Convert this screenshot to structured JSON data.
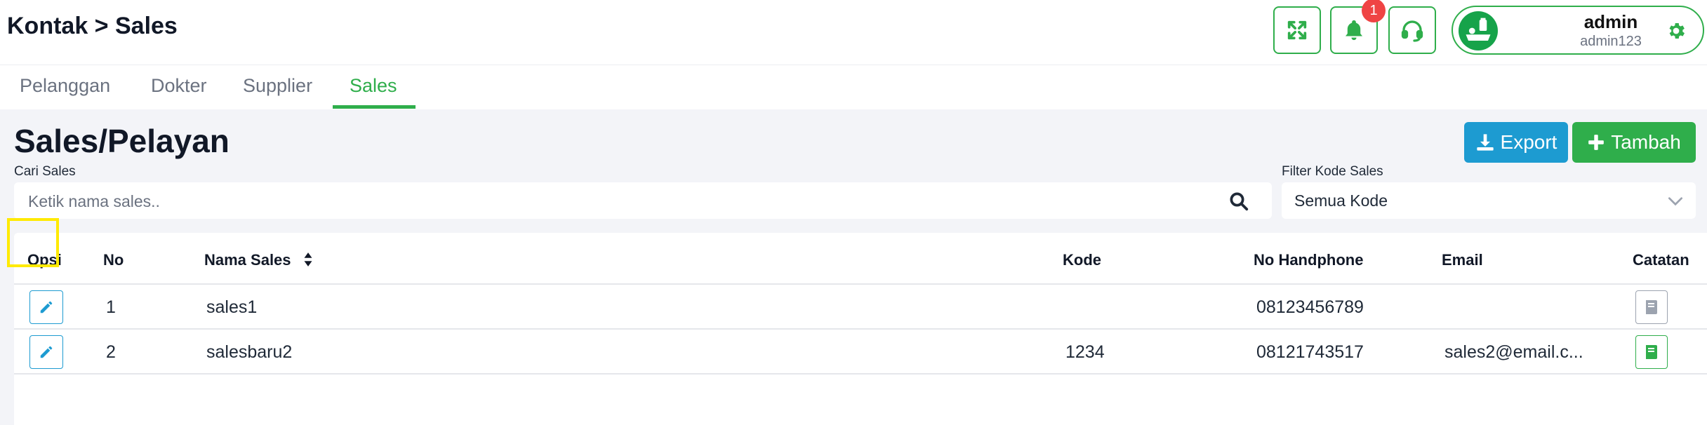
{
  "header": {
    "breadcrumb": "Kontak > Sales",
    "notifications_count": "1",
    "user": {
      "name": "admin",
      "id": "admin123"
    }
  },
  "tabs": [
    {
      "label": "Pelanggan"
    },
    {
      "label": "Dokter"
    },
    {
      "label": "Supplier"
    },
    {
      "label": "Sales"
    }
  ],
  "active_tab": "Sales",
  "page": {
    "title": "Sales/Pelayan",
    "export_label": "Export",
    "add_label": "Tambah"
  },
  "search": {
    "label": "Cari Sales",
    "placeholder": "Ketik nama sales.."
  },
  "filter": {
    "label": "Filter Kode Sales",
    "value": "Semua Kode"
  },
  "table": {
    "columns": [
      "Opsi",
      "No",
      "Nama Sales",
      "Kode",
      "No Handphone",
      "Email",
      "Catatan"
    ],
    "rows": [
      {
        "no": "1",
        "name": "sales1",
        "kode": "",
        "phone": "08123456789",
        "email": ""
      },
      {
        "no": "2",
        "name": "salesbaru2",
        "kode": "1234",
        "phone": "08121743517",
        "email": "sales2@email.c..."
      }
    ]
  },
  "colors": {
    "accent_green": "#2fae4b",
    "export_blue": "#1d9bd1",
    "badge_red": "#ef4444",
    "note_empty_gray": "#9ca3af",
    "highlight_yellow": "#ffea00"
  },
  "icons": {
    "fullscreen": "expand-arrows-icon",
    "notification": "bell-icon",
    "support": "headset-icon",
    "settings": "gear-icon",
    "search": "search-icon",
    "edit": "pencil-icon",
    "note": "book-icon",
    "sort": "sort-icon",
    "chevron": "chevron-down-icon",
    "download": "download-icon",
    "plus": "plus-icon"
  }
}
